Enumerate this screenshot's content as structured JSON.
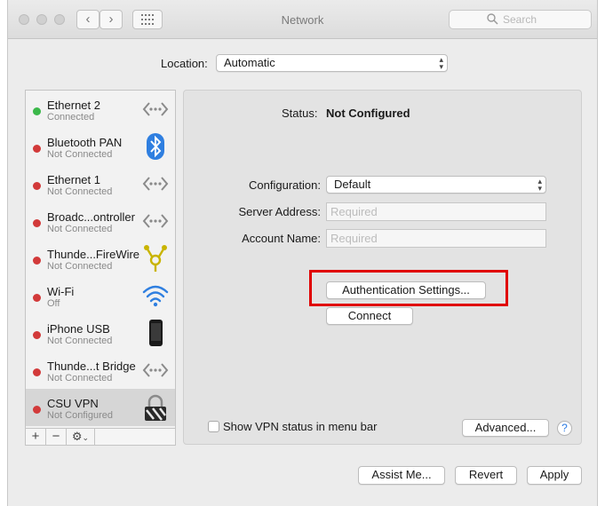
{
  "window": {
    "title": "Network",
    "search_placeholder": "Search"
  },
  "location": {
    "label": "Location:",
    "value": "Automatic"
  },
  "services": [
    {
      "name": "Ethernet 2",
      "status": "Connected",
      "dot": "green",
      "icon": "ethernet-icon"
    },
    {
      "name": "Bluetooth PAN",
      "status": "Not Connected",
      "dot": "red",
      "icon": "bluetooth-icon"
    },
    {
      "name": "Ethernet 1",
      "status": "Not Connected",
      "dot": "red",
      "icon": "ethernet-icon"
    },
    {
      "name": "Broadc...ontroller",
      "status": "Not Connected",
      "dot": "red",
      "icon": "ethernet-icon"
    },
    {
      "name": "Thunde...FireWire",
      "status": "Not Connected",
      "dot": "red",
      "icon": "firewire-icon"
    },
    {
      "name": "Wi-Fi",
      "status": "Off",
      "dot": "red",
      "icon": "wifi-icon"
    },
    {
      "name": "iPhone USB",
      "status": "Not Connected",
      "dot": "red",
      "icon": "iphone-icon"
    },
    {
      "name": "Thunde...t Bridge",
      "status": "Not Connected",
      "dot": "red",
      "icon": "ethernet-icon"
    },
    {
      "name": "CSU VPN",
      "status": "Not Configured",
      "dot": "red",
      "icon": "vpn-lock-icon",
      "selected": true
    }
  ],
  "sidebar_tools": {
    "add": "+",
    "remove": "−",
    "action": "⚙",
    "action_chevron": "⌄"
  },
  "detail": {
    "status_label": "Status:",
    "status_value": "Not Configured",
    "configuration_label": "Configuration:",
    "configuration_value": "Default",
    "server_address_label": "Server Address:",
    "server_address_placeholder": "Required",
    "account_name_label": "Account Name:",
    "account_name_placeholder": "Required",
    "auth_button": "Authentication Settings...",
    "connect_button": "Connect",
    "show_vpn_label": "Show VPN status in menu bar",
    "advanced_button": "Advanced...",
    "help": "?"
  },
  "footer": {
    "assist_button": "Assist Me...",
    "revert_button": "Revert",
    "apply_button": "Apply"
  },
  "colors": {
    "connected": "#3bb84a",
    "disconnected": "#d23a3a",
    "highlight": "#e00000",
    "bluetooth": "#2f7fe0"
  }
}
